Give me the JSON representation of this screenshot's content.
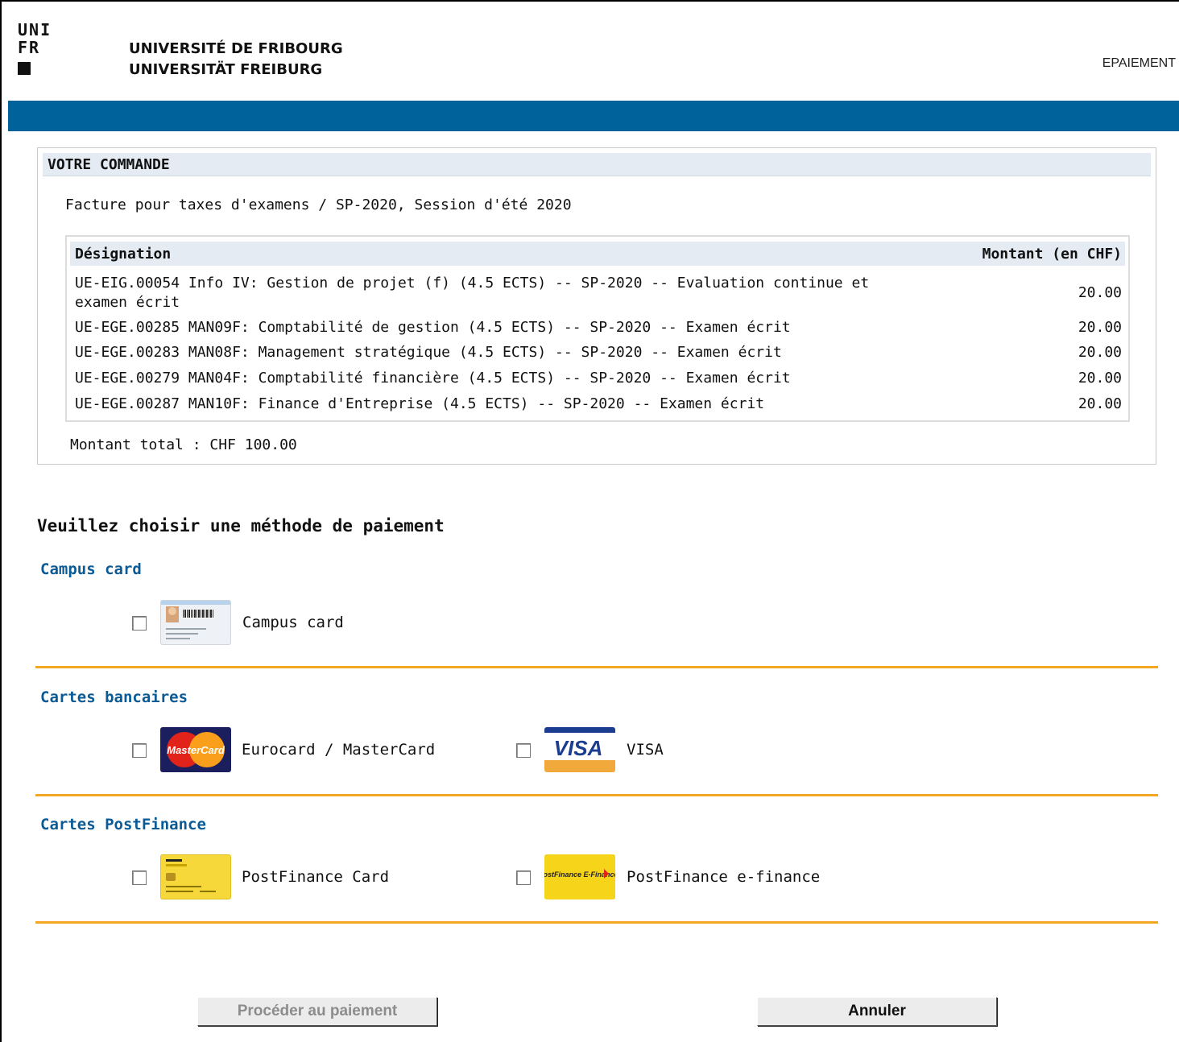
{
  "header": {
    "logo_line1": "UNI",
    "logo_line2": "FR",
    "university_fr": "UNIVERSITÉ DE FRIBOURG",
    "university_de": "UNIVERSITÄT FREIBURG",
    "app_name": "EPAIEMENT"
  },
  "order": {
    "title": "VOTRE COMMANDE",
    "invoice": "Facture pour taxes d'examens / SP-2020, Session d'été 2020",
    "columns": {
      "designation": "Désignation",
      "amount": "Montant (en CHF)"
    },
    "items": [
      {
        "designation": "UE-EIG.00054 Info IV: Gestion de projet (f) (4.5 ECTS) -- SP-2020 -- Evaluation continue et examen écrit",
        "amount": "20.00"
      },
      {
        "designation": "UE-EGE.00285 MAN09F: Comptabilité de gestion (4.5 ECTS) -- SP-2020 -- Examen écrit",
        "amount": "20.00"
      },
      {
        "designation": "UE-EGE.00283 MAN08F: Management stratégique (4.5 ECTS) -- SP-2020 -- Examen écrit",
        "amount": "20.00"
      },
      {
        "designation": "UE-EGE.00279 MAN04F: Comptabilité financière (4.5 ECTS) -- SP-2020 -- Examen écrit",
        "amount": "20.00"
      },
      {
        "designation": "UE-EGE.00287 MAN10F: Finance d'Entreprise (4.5 ECTS) -- SP-2020 -- Examen écrit",
        "amount": "20.00"
      }
    ],
    "total": "Montant total : CHF 100.00"
  },
  "payment": {
    "title": "Veuillez choisir une méthode de paiement",
    "categories": [
      {
        "title": "Campus card",
        "methods": [
          {
            "label": "Campus card",
            "icon": "campus-card-icon",
            "checked": false
          }
        ]
      },
      {
        "title": "Cartes bancaires",
        "methods": [
          {
            "label": "Eurocard / MasterCard",
            "icon": "mastercard-icon",
            "icon_text": "MasterCard",
            "checked": false
          },
          {
            "label": "VISA",
            "icon": "visa-icon",
            "icon_text": "VISA",
            "checked": false
          }
        ]
      },
      {
        "title": "Cartes PostFinance",
        "methods": [
          {
            "label": "PostFinance Card",
            "icon": "postfinance-card-icon",
            "checked": false
          },
          {
            "label": "PostFinance e-finance",
            "icon": "postfinance-efinance-icon",
            "icon_text": "PostFinance E-Finance",
            "checked": false
          }
        ]
      }
    ],
    "colors": {
      "accent_blue": "#00629b",
      "category_title": "#0a5a96",
      "separator": "#f5a623"
    }
  },
  "buttons": {
    "proceed": "Procéder au paiement",
    "proceed_disabled": true,
    "cancel": "Annuler"
  }
}
